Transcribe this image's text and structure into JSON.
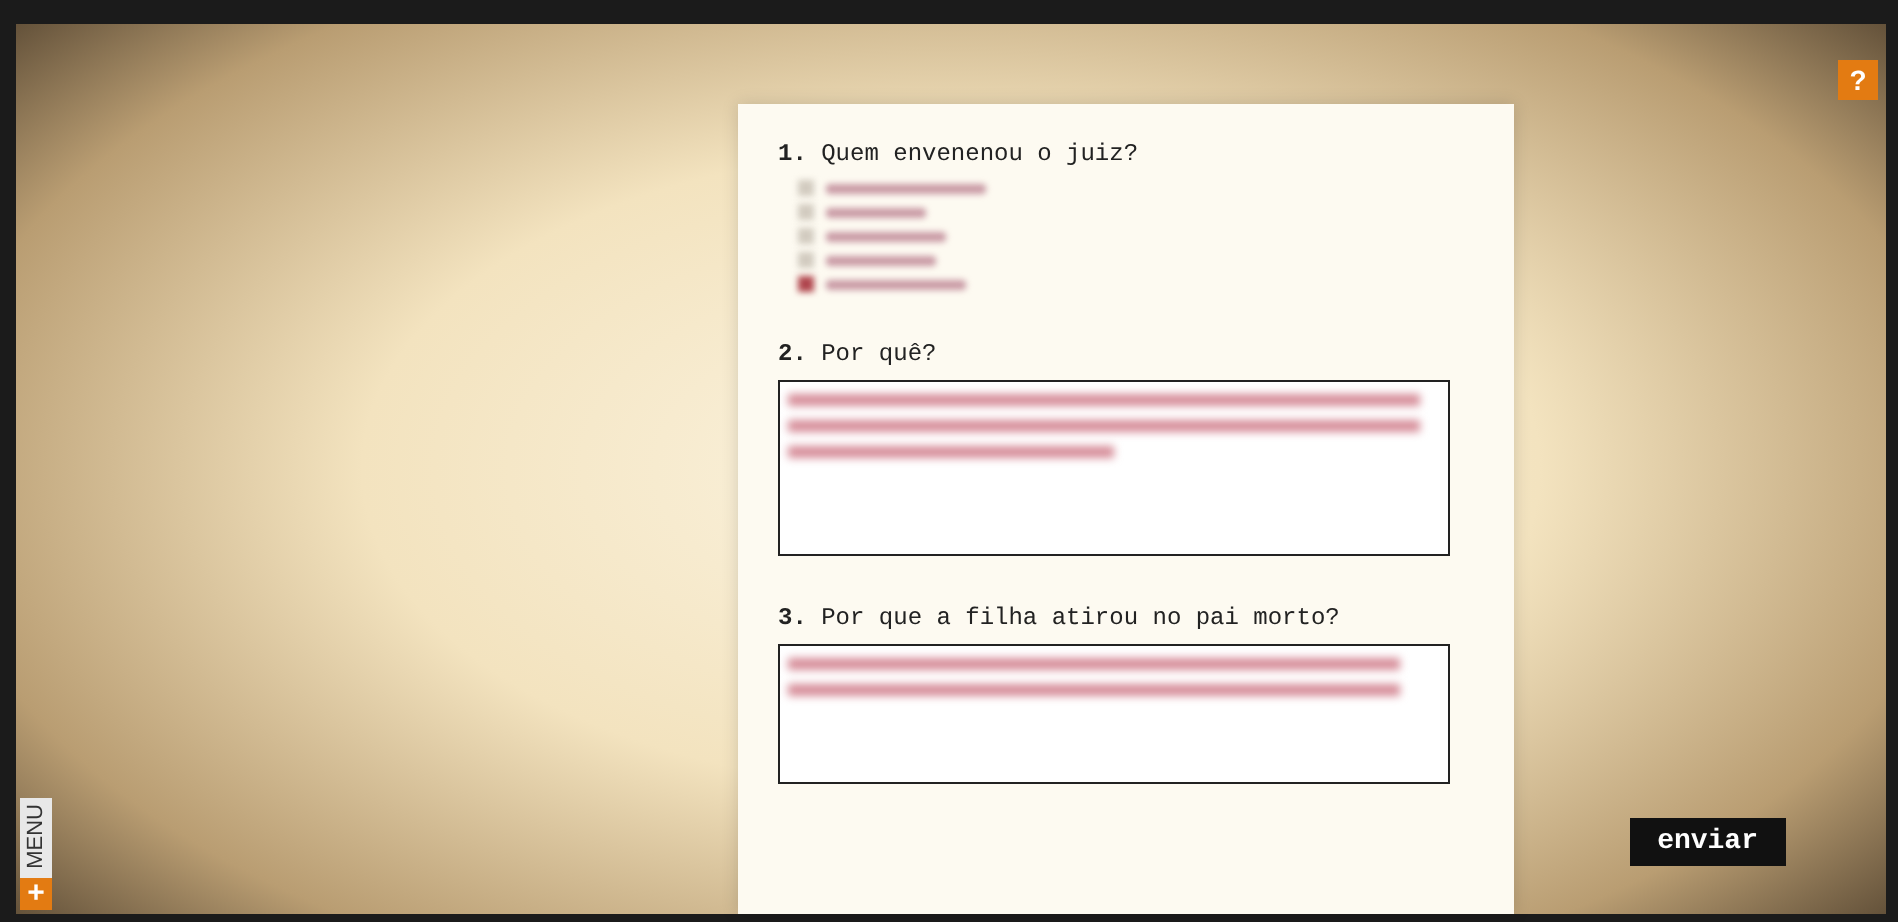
{
  "help_button": "?",
  "menu": {
    "icon": "+",
    "label": "MENU"
  },
  "questions": [
    {
      "kind": "choice",
      "number": "1.",
      "text": "Quem envenenou o juiz?",
      "options": [
        {
          "checked": false
        },
        {
          "checked": false
        },
        {
          "checked": false
        },
        {
          "checked": false
        },
        {
          "checked": true
        }
      ]
    },
    {
      "kind": "text",
      "number": "2.",
      "text": "Por quê?"
    },
    {
      "kind": "text",
      "number": "3.",
      "text": "Por que a filha atirou no pai morto?"
    }
  ],
  "submit": "enviar"
}
